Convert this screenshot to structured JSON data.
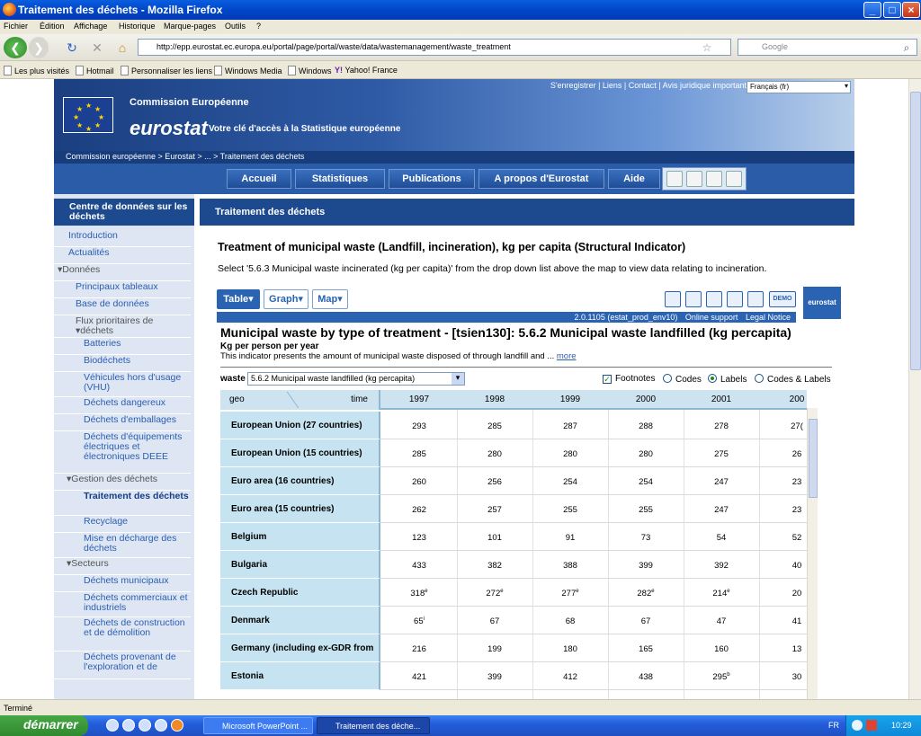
{
  "window": {
    "title": "Traitement des déchets - Mozilla Firefox"
  },
  "menu": [
    "Fichier",
    "Édition",
    "Affichage",
    "Historique",
    "Marque-pages",
    "Outils",
    "?"
  ],
  "nav": {
    "url": "http://epp.eurostat.ec.europa.eu/portal/page/portal/waste/data/wastemanagement/waste_treatment",
    "search_placeholder": "Google"
  },
  "bookmarks": [
    "Les plus visités",
    "Hotmail",
    "Personnaliser les liens",
    "Windows Media",
    "Windows",
    "Yahoo! France"
  ],
  "header": {
    "top_links": "S'enregistrer | Liens | Contact | Avis juridique important",
    "language": "Français (fr)",
    "commission": "Commission Européenne",
    "brand": "eurostat",
    "tagline": "Votre clé d'accès à la Statistique européenne",
    "breadcrumb": "Commission européenne > Eurostat > ... > Traitement des déchets",
    "main_nav": [
      "Accueil",
      "Statistiques",
      "Publications",
      "A propos d'Eurostat",
      "Aide"
    ]
  },
  "sidebar": {
    "title": "Centre de données sur les déchets",
    "items": [
      {
        "label": "Introduction"
      },
      {
        "label": "Actualités"
      },
      {
        "label": "▾Données"
      },
      {
        "label": "Principaux tableaux"
      },
      {
        "label": "Base de données"
      },
      {
        "label": "Flux prioritaires de ▾déchets"
      },
      {
        "label": "Batteries"
      },
      {
        "label": "Biodéchets"
      },
      {
        "label": "Véhicules hors d'usage (VHU)"
      },
      {
        "label": "Déchets dangereux"
      },
      {
        "label": "Déchets d'emballages"
      },
      {
        "label": "Déchets d'équipements électriques et électroniques DEEE"
      },
      {
        "label": "▾Gestion des déchets"
      },
      {
        "label": "Traitement des déchets"
      },
      {
        "label": "Recyclage"
      },
      {
        "label": "Mise en décharge des déchets"
      },
      {
        "label": "▾Secteurs"
      },
      {
        "label": "Déchets municipaux"
      },
      {
        "label": "Déchets commerciaux et industriels"
      },
      {
        "label": "Déchets de construction et de démolition"
      },
      {
        "label": "Déchets provenant de l'exploration et de"
      }
    ]
  },
  "main": {
    "header": "Traitement des déchets",
    "title": "Treatment of municipal waste (Landfill, incineration), kg per capita (Structural Indicator)",
    "subtitle": "Select '5.6.3 Municipal waste incinerated (kg per capita)' from the drop down list above the map to view data relating to incineration.",
    "tabs": [
      "Table",
      "Graph",
      "Map"
    ],
    "demo_label": "DEMO",
    "logo_label": "eurostat",
    "version": "2.0.1105 (estat_prod_env10)",
    "online_support": "Online support",
    "legal_notice": "Legal Notice",
    "table_title": "Municipal waste by type of treatment - [tsien130]: 5.6.2 Municipal waste landfilled (kg percapita)",
    "unit": "Kg per person per year",
    "description": "This indicator presents the amount of municipal waste disposed of through landfill and ...",
    "more": "more",
    "filter_label": "waste",
    "filter_value": "5.6.2 Municipal waste landfilled (kg percapita)",
    "options": {
      "footnotes": "Footnotes",
      "codes": "Codes",
      "labels": "Labels",
      "codes_labels": "Codes & Labels"
    }
  },
  "table": {
    "geo_label": "geo",
    "time_label": "time",
    "years": [
      "1997",
      "1998",
      "1999",
      "2000",
      "2001",
      "200"
    ],
    "rows": [
      {
        "geo": "European Union (27 countries)",
        "v": [
          "293",
          "285",
          "287",
          "288",
          "278",
          "27("
        ],
        "f": [
          "",
          "",
          "",
          "",
          "",
          ""
        ]
      },
      {
        "geo": "European Union (15 countries)",
        "v": [
          "285",
          "280",
          "280",
          "280",
          "275",
          "26"
        ],
        "f": [
          "",
          "",
          "",
          "",
          "",
          ""
        ]
      },
      {
        "geo": "Euro area (16 countries)",
        "v": [
          "260",
          "256",
          "254",
          "254",
          "247",
          "23"
        ],
        "f": [
          "",
          "",
          "",
          "",
          "",
          ""
        ]
      },
      {
        "geo": "Euro area (15 countries)",
        "v": [
          "262",
          "257",
          "255",
          "255",
          "247",
          "23"
        ],
        "f": [
          "",
          "",
          "",
          "",
          "",
          ""
        ]
      },
      {
        "geo": "Belgium",
        "v": [
          "123",
          "101",
          "91",
          "73",
          "54",
          "52"
        ],
        "f": [
          "",
          "",
          "",
          "",
          "",
          ""
        ]
      },
      {
        "geo": "Bulgaria",
        "v": [
          "433",
          "382",
          "388",
          "399",
          "392",
          "40"
        ],
        "f": [
          "",
          "",
          "",
          "",
          "",
          ""
        ]
      },
      {
        "geo": "Czech Republic",
        "v": [
          "318",
          "272",
          "277",
          "282",
          "214",
          "20"
        ],
        "f": [
          "e",
          "e",
          "e",
          "e",
          "e",
          ""
        ]
      },
      {
        "geo": "Denmark",
        "v": [
          "65",
          "67",
          "68",
          "67",
          "47",
          "41"
        ],
        "f": [
          "i",
          "",
          "",
          "",
          "",
          ""
        ]
      },
      {
        "geo": "Germany (including ex-GDR from",
        "v": [
          "216",
          "199",
          "180",
          "165",
          "160",
          "13"
        ],
        "f": [
          "",
          "",
          "",
          "",
          "",
          ""
        ]
      },
      {
        "geo": "Estonia",
        "v": [
          "421",
          "399",
          "412",
          "438",
          "295",
          "30"
        ],
        "f": [
          "",
          "",
          "",
          "",
          "b",
          ""
        ]
      }
    ]
  },
  "status": "Terminé",
  "taskbar": {
    "start": "démarrer",
    "tasks": [
      "Microsoft PowerPoint ...",
      "Traitement des déche..."
    ],
    "lang": "FR",
    "time": "10:29"
  }
}
